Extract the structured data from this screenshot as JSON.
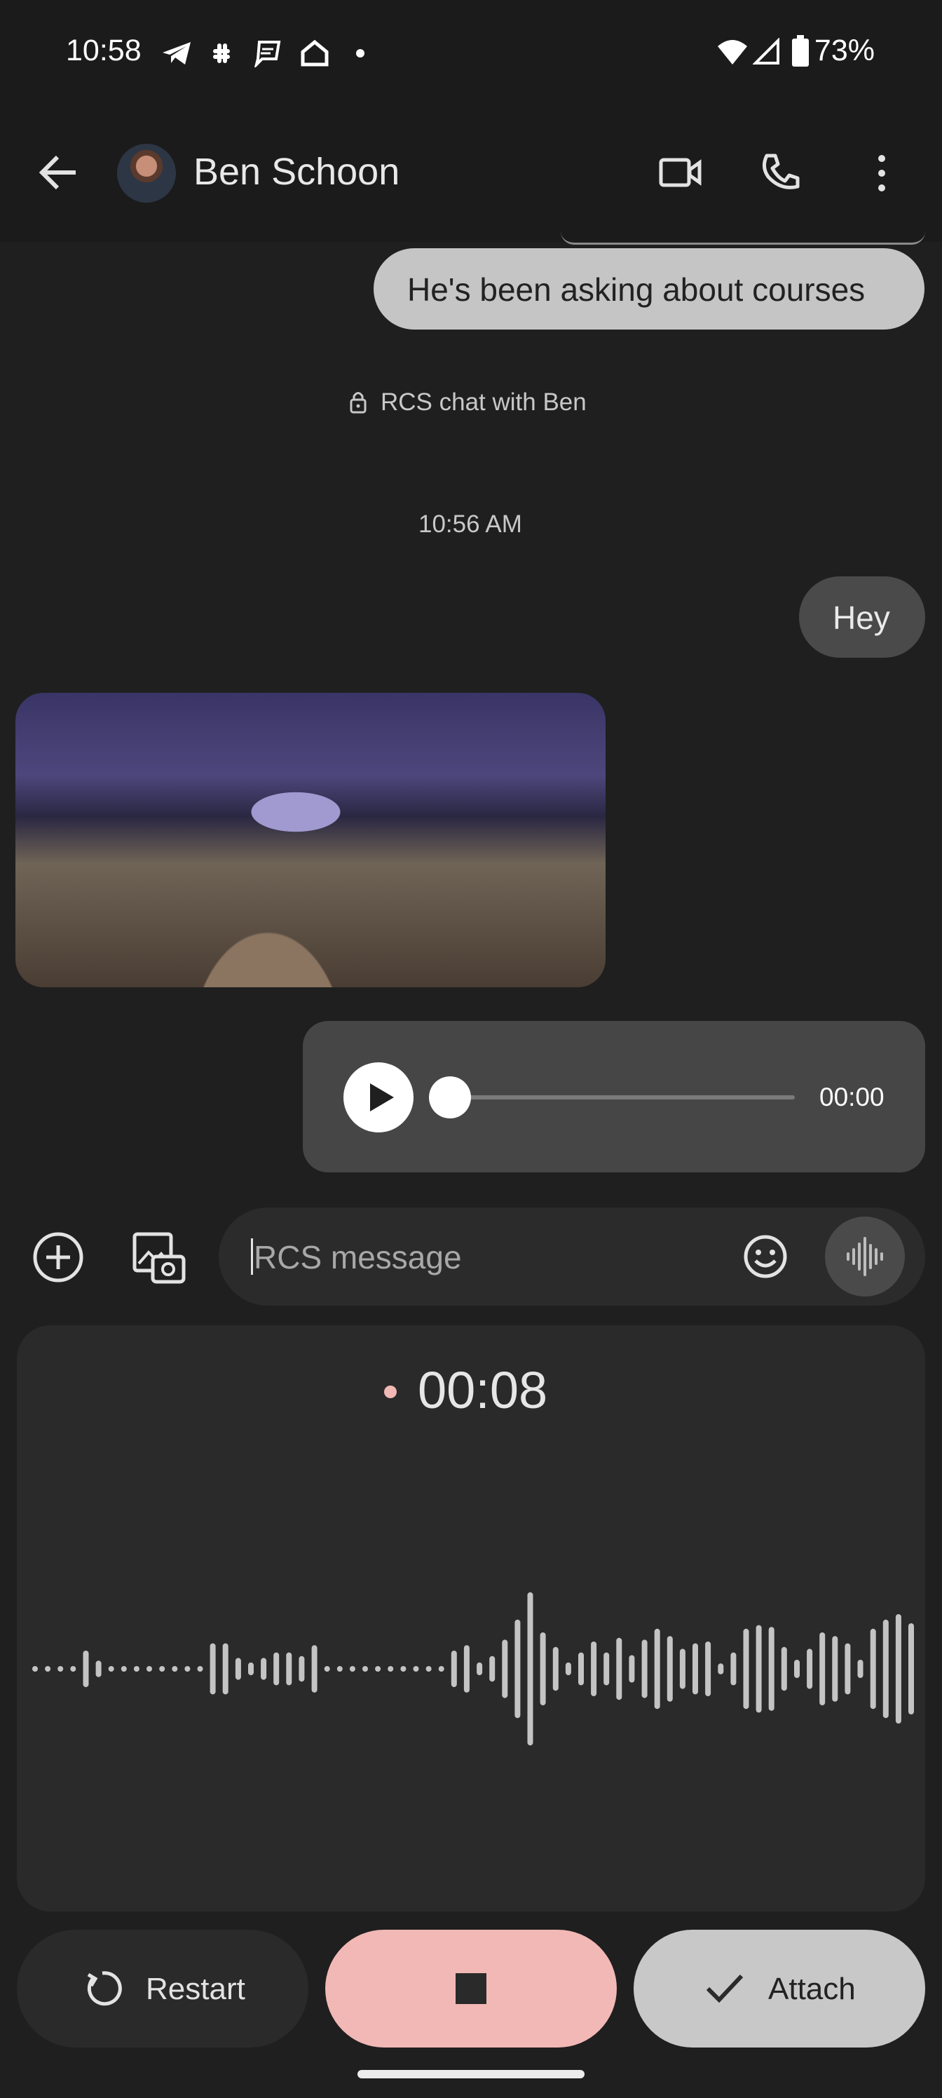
{
  "status_bar": {
    "time": "10:58",
    "battery": "73%",
    "icons": [
      "telegram-icon",
      "slack-icon",
      "chat-icon",
      "home-icon",
      "dot-icon",
      "wifi-icon",
      "signal-icon",
      "battery-icon"
    ]
  },
  "header": {
    "contact_name": "Ben Schoon",
    "actions": [
      "video-call-icon",
      "phone-icon",
      "more-icon"
    ]
  },
  "messages": {
    "previous_outgoing": "He's been asking about courses",
    "rcs_notice": "RCS chat with Ben",
    "timestamp": "10:56 AM",
    "hey": "Hey",
    "audio_duration": "00:00",
    "audio_progress": 0
  },
  "compose": {
    "placeholder": "RCS message"
  },
  "recorder": {
    "elapsed": "00:08",
    "waveform_levels": [
      0.03,
      0.03,
      0.03,
      0.03,
      0.2,
      0.09,
      0.03,
      0.03,
      0.03,
      0.03,
      0.03,
      0.03,
      0.03,
      0.03,
      0.28,
      0.28,
      0.12,
      0.07,
      0.12,
      0.18,
      0.18,
      0.14,
      0.26,
      0.03,
      0.03,
      0.03,
      0.03,
      0.03,
      0.03,
      0.03,
      0.03,
      0.03,
      0.03,
      0.2,
      0.26,
      0.07,
      0.14,
      0.32,
      0.54,
      0.84,
      0.4,
      0.24,
      0.07,
      0.18,
      0.3,
      0.18,
      0.34,
      0.15,
      0.32,
      0.44,
      0.36,
      0.22,
      0.28,
      0.3,
      0.06,
      0.18,
      0.44,
      0.48,
      0.46,
      0.24,
      0.1,
      0.22,
      0.4,
      0.36,
      0.28,
      0.1,
      0.44,
      0.54,
      0.6,
      0.5
    ]
  },
  "controls": {
    "restart": "Restart",
    "attach": "Attach"
  }
}
